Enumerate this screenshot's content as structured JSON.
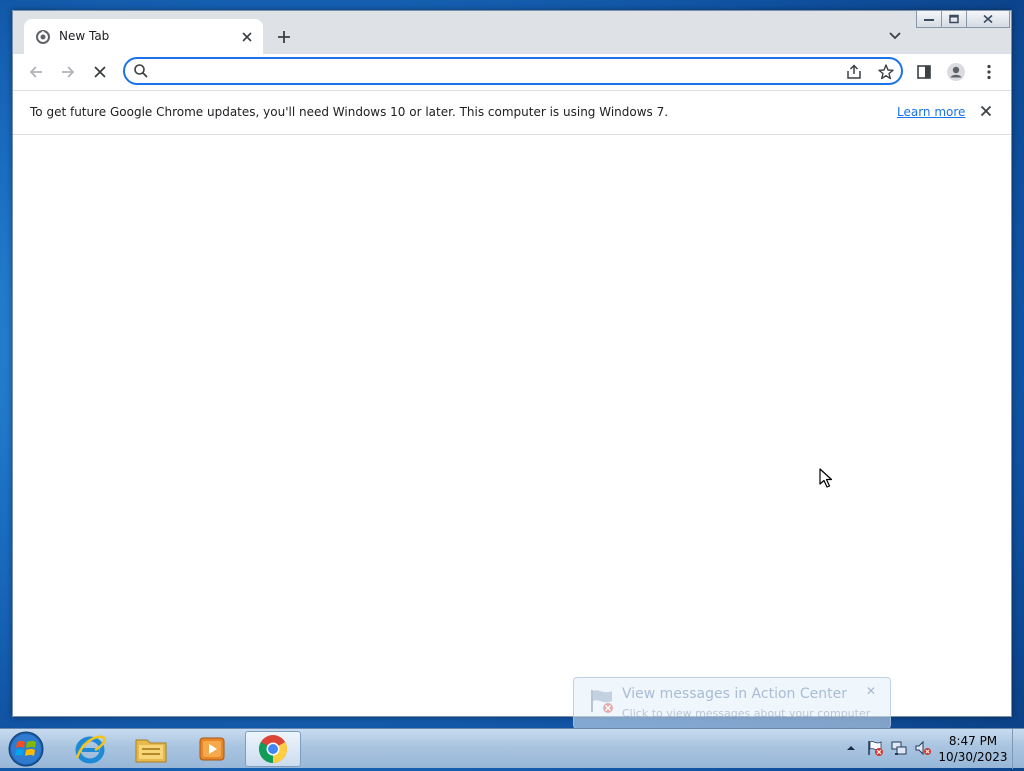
{
  "browser": {
    "tab": {
      "title": "New Tab",
      "favicon": "chrome-newtab-icon"
    },
    "toolbar": {
      "omnibox_value": "",
      "icons": [
        "back-arrow-icon",
        "forward-arrow-icon",
        "stop-loading-icon",
        "search-icon",
        "share-icon",
        "star-icon",
        "side-panel-icon",
        "profile-icon",
        "more-menu-icon"
      ]
    },
    "infobar": {
      "message": "To get future Google Chrome updates, you'll need Windows 10 or later. This computer is using Windows 7.",
      "link": "Learn more"
    }
  },
  "notification": {
    "title": "View messages in Action Center",
    "subtitle": "Click to view messages about your computer"
  },
  "taskbar": {
    "apps": [
      "internet-explorer-icon",
      "windows-explorer-icon",
      "media-player-icon",
      "chrome-icon"
    ],
    "clock": {
      "time": "8:47 PM",
      "date": "10/30/2023"
    }
  },
  "colors": {
    "accent": "#1a73e8",
    "tabstrip": "#dee1e6",
    "taskbar": "#a9c4e0"
  }
}
